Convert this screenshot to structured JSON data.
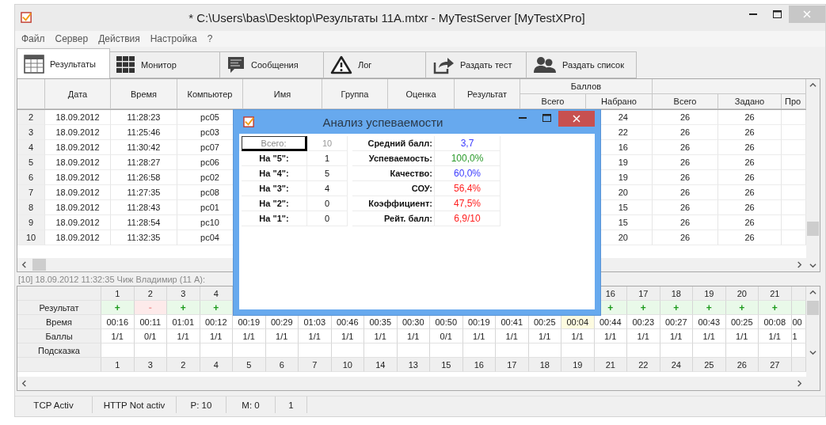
{
  "window": {
    "title": "* C:\\Users\\bas\\Desktop\\Результаты 11А.mtxr - MyTestServer [MyTestXPro]"
  },
  "menu": [
    "Файл",
    "Сервер",
    "Действия",
    "Настройка",
    "?"
  ],
  "tabs": [
    {
      "label": "Результаты",
      "selected": true
    },
    {
      "label": "Монитор",
      "selected": false
    },
    {
      "label": "Сообщения",
      "selected": false
    },
    {
      "label": "Лог",
      "selected": false
    }
  ],
  "toolbar_buttons": [
    "Раздать тест",
    "Раздать список"
  ],
  "results_table": {
    "columns": [
      "Дата",
      "Время",
      "Компьютер",
      "Имя",
      "Группа",
      "Оценка",
      "Результат"
    ],
    "group_header": "Баллов",
    "sub_columns": [
      "Всего",
      "Набрано",
      "Всего",
      "Задано",
      "Про"
    ],
    "rows": [
      {
        "num": "2",
        "date": "18.09.2012",
        "time": "11:28:23",
        "computer": "pc05",
        "scored": "24",
        "total": "26",
        "given": "26"
      },
      {
        "num": "3",
        "date": "18.09.2012",
        "time": "11:25:46",
        "computer": "pc03",
        "scored": "22",
        "total": "26",
        "given": "26"
      },
      {
        "num": "4",
        "date": "18.09.2012",
        "time": "11:30:42",
        "computer": "pc07",
        "scored": "16",
        "total": "26",
        "given": "26"
      },
      {
        "num": "5",
        "date": "18.09.2012",
        "time": "11:28:27",
        "computer": "pc06",
        "scored": "19",
        "total": "26",
        "given": "26"
      },
      {
        "num": "6",
        "date": "18.09.2012",
        "time": "11:26:58",
        "computer": "pc02",
        "scored": "19",
        "total": "26",
        "given": "26"
      },
      {
        "num": "7",
        "date": "18.09.2012",
        "time": "11:27:35",
        "computer": "pc08",
        "scored": "20",
        "total": "26",
        "given": "26"
      },
      {
        "num": "8",
        "date": "18.09.2012",
        "time": "11:28:43",
        "computer": "pc01",
        "scored": "15",
        "total": "26",
        "given": "26"
      },
      {
        "num": "9",
        "date": "18.09.2012",
        "time": "11:28:54",
        "computer": "pc10",
        "scored": "15",
        "total": "26",
        "given": "26"
      },
      {
        "num": "10",
        "date": "18.09.2012",
        "time": "11:32:35",
        "computer": "pc04",
        "scored": "20",
        "total": "26",
        "given": "26"
      }
    ]
  },
  "detail_line": "[10] 18.09.2012 11:32:35  Чиж Владимир (11 А):",
  "answers_table": {
    "row_labels": [
      "Результат",
      "Время",
      "Баллы",
      "Подсказка"
    ],
    "questions": [
      {
        "number": "1",
        "result": "+",
        "correct": true,
        "time": "00:16",
        "score": "1/1",
        "order": "1"
      },
      {
        "number": "2",
        "result": "-",
        "correct": false,
        "time": "00:11",
        "score": "0/1",
        "order": "3"
      },
      {
        "number": "3",
        "result": "+",
        "correct": true,
        "time": "01:01",
        "score": "1/1",
        "order": "2"
      },
      {
        "number": "4",
        "result": "+",
        "correct": true,
        "time": "00:12",
        "score": "1/1",
        "order": "4"
      },
      {
        "time": "00:19",
        "score": "1/1",
        "order": "5"
      },
      {
        "time": "00:29",
        "score": "1/1",
        "order": "6"
      },
      {
        "time": "01:03",
        "score": "1/1",
        "order": "7"
      },
      {
        "time": "00:46",
        "score": "1/1",
        "order": "10"
      },
      {
        "time": "00:35",
        "score": "1/1",
        "order": "14"
      },
      {
        "time": "00:30",
        "score": "1/1",
        "order": "13"
      },
      {
        "time": "00:50",
        "score": "0/1",
        "order": "15"
      },
      {
        "time": "00:19",
        "score": "1/1",
        "order": "16"
      },
      {
        "time": "00:41",
        "score": "1/1",
        "order": "17"
      },
      {
        "time": "00:25",
        "score": "1/1",
        "order": "18"
      },
      {
        "time": "00:04",
        "score": "1/1",
        "order": "19",
        "highlighted": true
      },
      {
        "number": "16",
        "result": "+",
        "correct": true,
        "time": "00:44",
        "score": "1/1",
        "order": "21"
      },
      {
        "number": "17",
        "result": "+",
        "correct": true,
        "time": "00:23",
        "score": "1/1",
        "order": "22"
      },
      {
        "number": "18",
        "result": "+",
        "correct": true,
        "time": "00:27",
        "score": "1/1",
        "order": "24"
      },
      {
        "number": "19",
        "result": "+",
        "correct": true,
        "time": "00:43",
        "score": "1/1",
        "order": "25"
      },
      {
        "number": "20",
        "result": "+",
        "correct": true,
        "time": "00:25",
        "score": "1/1",
        "order": "26"
      },
      {
        "number": "21",
        "result": "+",
        "correct": true,
        "time": "00:08",
        "score": "1/1",
        "order": "27"
      },
      {
        "time": "00",
        "score": "1"
      }
    ]
  },
  "status_bar": [
    "TCP Activ",
    "HTTP Not activ",
    "P: 10",
    "M: 0",
    "1"
  ],
  "dialog": {
    "title": "Анализ успеваемости",
    "counts": [
      {
        "label": "Всего:",
        "value": "10",
        "focused": true
      },
      {
        "label": "На \"5\":",
        "value": "1",
        "focused": false
      },
      {
        "label": "На \"4\":",
        "value": "5",
        "focused": false
      },
      {
        "label": "На \"3\":",
        "value": "4",
        "focused": false
      },
      {
        "label": "На \"2\":",
        "value": "0",
        "focused": false
      },
      {
        "label": "На \"1\":",
        "value": "0",
        "focused": false
      }
    ],
    "metrics": [
      {
        "label": "Средний балл:",
        "value": "3,7",
        "color": "#3b3bff"
      },
      {
        "label": "Успеваемость:",
        "value": "100,0%",
        "color": "#2a9a2a"
      },
      {
        "label": "Качество:",
        "value": "60,0%",
        "color": "#3b3bff"
      },
      {
        "label": "СОУ:",
        "value": "56,4%",
        "color": "#ff2020"
      },
      {
        "label": "Коэффициент:",
        "value": "47,5%",
        "color": "#ff2020"
      },
      {
        "label": "Рейт. балл:",
        "value": "6,9/10",
        "color": "#ff2020"
      }
    ]
  }
}
